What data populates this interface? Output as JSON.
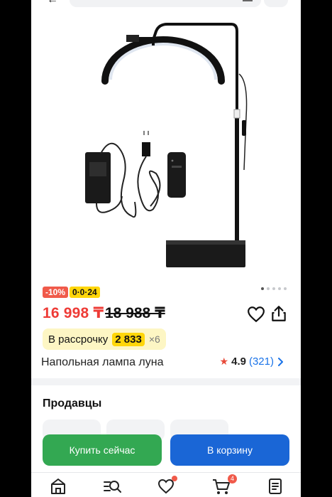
{
  "gallery": {
    "image_alt": "floor moon lamp product photo",
    "dots_count": 5,
    "active_dot": 1
  },
  "badges": {
    "discount": "-10%",
    "installment": "0·0·24"
  },
  "price": {
    "current": "16 998 ₸",
    "old": "18 988 ₸"
  },
  "installment": {
    "label": "В рассрочку",
    "amount": "2 833",
    "multiplier": "×6"
  },
  "product": {
    "title": "Напольная лампа луна",
    "rating": "4.9",
    "reviews": "(321)"
  },
  "sellers": {
    "title": "Продавцы"
  },
  "actions": {
    "buy_now": "Купить сейчас",
    "add_to_cart": "В корзину"
  },
  "bottom_nav": {
    "cart_count": "4"
  },
  "colors": {
    "price_red": "#ee3b36",
    "buy_green": "#33a852",
    "cart_blue": "#1a66d6",
    "badge_yellow": "#ffd60a",
    "badge_red": "#f05a4a"
  }
}
